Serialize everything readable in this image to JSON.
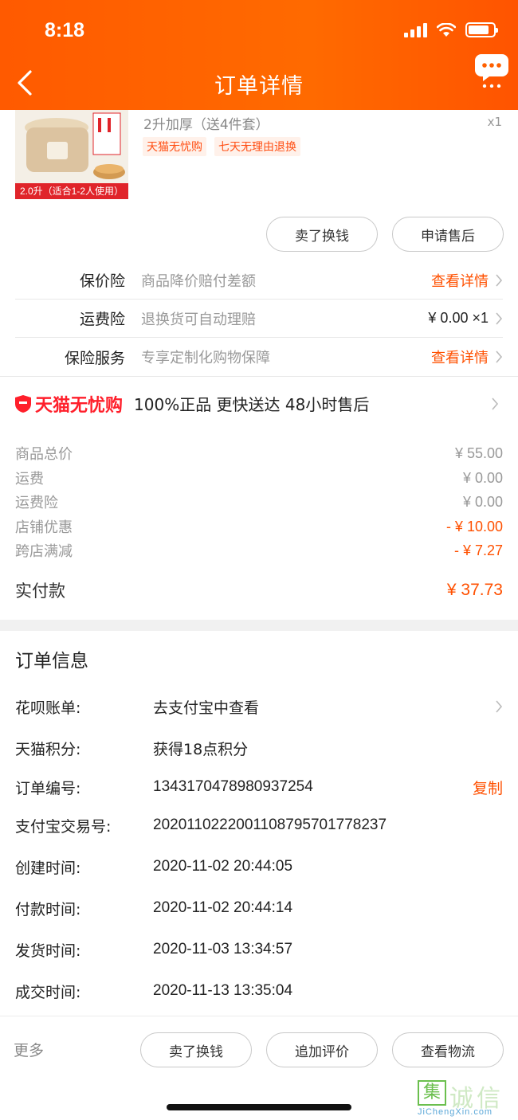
{
  "status_bar": {
    "time": "8:18"
  },
  "header": {
    "title": "订单详情"
  },
  "product": {
    "name": "2升加厚（送4件套）",
    "quantity": "x1",
    "image_caption": "2.0升（适合1-2人使用）",
    "tags": [
      "天猫无忧购",
      "七天无理由退换"
    ],
    "actions": [
      "卖了换钱",
      "申请售后"
    ]
  },
  "insurance": [
    {
      "label": "保价险",
      "desc": "商品降价赔付差额",
      "value": "查看详情",
      "value_style": "link"
    },
    {
      "label": "运费险",
      "desc": "退换货可自动理赔",
      "value": "¥ 0.00 ×1",
      "value_style": "plain"
    },
    {
      "label": "保险服务",
      "desc": "专享定制化购物保障",
      "value": "查看详情",
      "value_style": "link"
    }
  ],
  "wuyou": {
    "logo": "天猫无忧购",
    "text": "100%正品  更快送达  48小时售后"
  },
  "price": {
    "lines": [
      {
        "label": "商品总价",
        "value": "¥ 55.00",
        "orange": false
      },
      {
        "label": "运费",
        "value": "¥ 0.00",
        "orange": false
      },
      {
        "label": "运费险",
        "value": "¥ 0.00",
        "orange": false
      },
      {
        "label": "店铺优惠",
        "value": "- ¥ 10.00",
        "orange": true
      },
      {
        "label": "跨店满减",
        "value": "- ¥ 7.27",
        "orange": true
      }
    ],
    "total_label": "实付款",
    "total_value": "¥ 37.73"
  },
  "order_info": {
    "title": "订单信息",
    "rows": [
      {
        "key": "花呗账单:",
        "value": "去支付宝中查看"
      },
      {
        "key": "天猫积分:",
        "value": "获得18点积分"
      },
      {
        "key": "订单编号:",
        "value": "1343170478980937254",
        "action": "复制"
      },
      {
        "key": "支付宝交易号:",
        "value": "2020110222001108795701778237"
      },
      {
        "key": "创建时间:",
        "value": "2020-11-02 20:44:05"
      },
      {
        "key": "付款时间:",
        "value": "2020-11-02 20:44:14"
      },
      {
        "key": "发货时间:",
        "value": "2020-11-03 13:34:57"
      },
      {
        "key": "成交时间:",
        "value": "2020-11-13 13:35:04"
      }
    ]
  },
  "bottom_bar": {
    "more": "更多",
    "buttons": [
      "卖了换钱",
      "追加评价",
      "查看物流"
    ]
  },
  "watermark": {
    "box_char": "集",
    "text": "诚信",
    "url": "JiChengXin.com"
  },
  "colors": {
    "accent": "#ff5000",
    "header": "#ff6000",
    "tmall_red": "#ff1f2b"
  }
}
